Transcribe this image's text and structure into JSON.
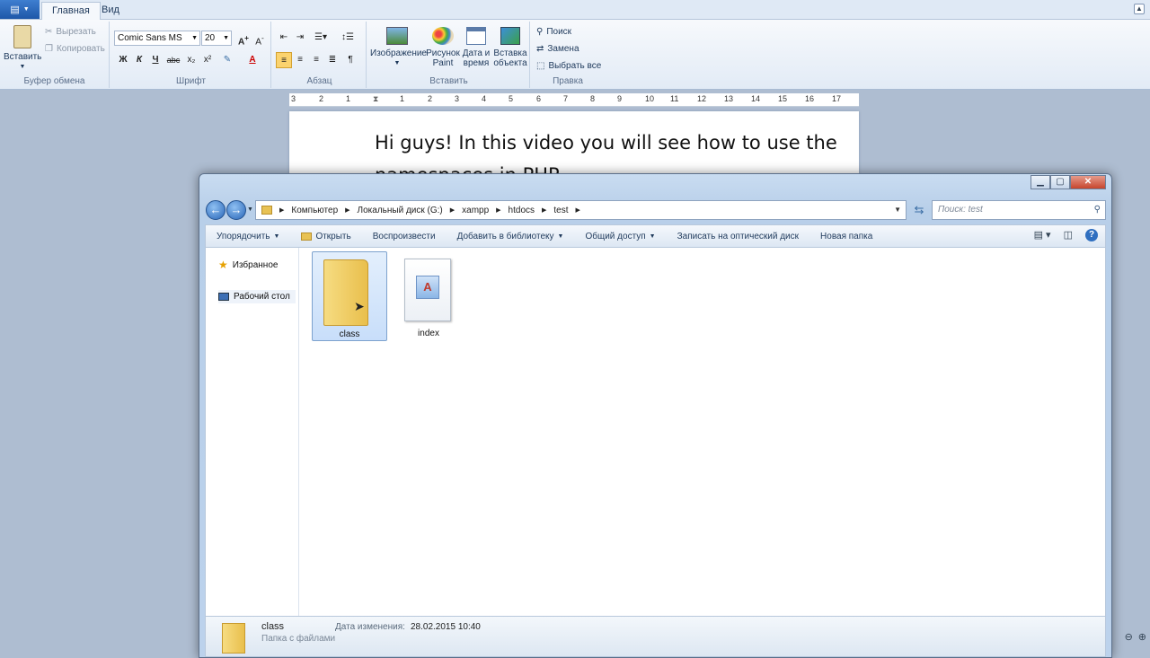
{
  "wordpad": {
    "tabs": [
      "Главная",
      "Вид"
    ],
    "clipboard": {
      "paste": "Вставить",
      "cut": "Вырезать",
      "copy": "Копировать",
      "group": "Буфер обмена"
    },
    "font": {
      "family": "Comic Sans MS",
      "size": "20",
      "group": "Шрифт",
      "bold": "Ж",
      "italic": "К",
      "underline": "Ч",
      "strike": "abc",
      "sub": "x₂",
      "sup": "x²"
    },
    "paragraph": {
      "group": "Абзац"
    },
    "insert": {
      "image": "Изображение",
      "paint": "Рисунок Paint",
      "datetime": "Дата и время",
      "object": "Вставка объекта",
      "group": "Вставить"
    },
    "editing": {
      "find": "Поиск",
      "replace": "Замена",
      "select_all": "Выбрать все",
      "group": "Правка"
    },
    "ruler": [
      "3",
      "2",
      "1",
      "1",
      "2",
      "3",
      "4",
      "5",
      "6",
      "7",
      "8",
      "9",
      "10",
      "11",
      "12",
      "13",
      "14",
      "15",
      "16",
      "17"
    ],
    "document_text": "Hi guys! In this video you will see how to use the namespaces in PHP."
  },
  "explorer": {
    "breadcrumb": [
      "Компьютер",
      "Локальный диск (G:)",
      "xampp",
      "htdocs",
      "test"
    ],
    "search_placeholder": "Поиск: test",
    "commands": [
      "Упорядочить",
      "Открыть",
      "Воспроизвести",
      "Добавить в библиотеку",
      "Общий доступ",
      "Записать на оптический диск",
      "Новая папка"
    ],
    "nav": [
      "Избранное",
      "Рабочий стол"
    ],
    "files": [
      {
        "name": "class",
        "type": "folder",
        "selected": true
      },
      {
        "name": "index",
        "type": "document",
        "selected": false
      }
    ],
    "details": {
      "name": "class",
      "modified_label": "Дата изменения:",
      "modified": "28.02.2015 10:40",
      "type": "Папка с файлами"
    }
  },
  "colors": {
    "accent": "#2966b8",
    "selection": "#c8defa",
    "folder": "#f3d06b"
  }
}
